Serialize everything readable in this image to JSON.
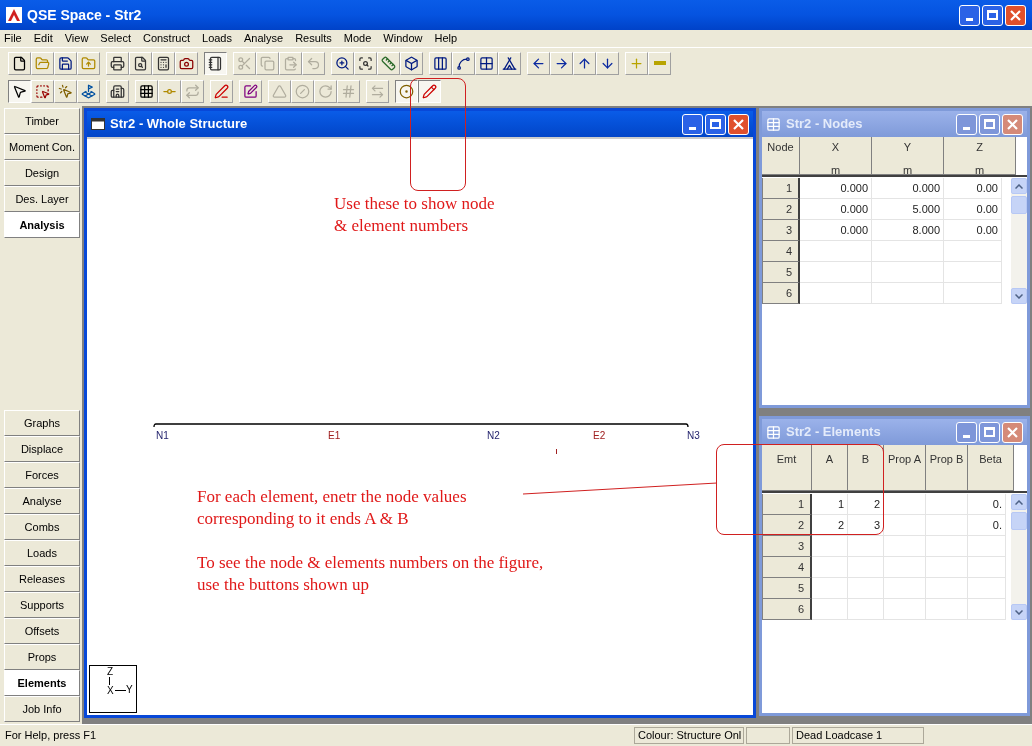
{
  "window": {
    "title": "QSE Space - Str2"
  },
  "menu": [
    "File",
    "Edit",
    "View",
    "Select",
    "Construct",
    "Loads",
    "Analyse",
    "Results",
    "Mode",
    "Window",
    "Help"
  ],
  "toolbar_1": [
    {
      "disabled": false,
      "pressed": false
    },
    {
      "disabled": false,
      "pressed": false
    },
    {
      "disabled": false,
      "pressed": false
    },
    {
      "disabled": false,
      "pressed": false
    },
    {
      "disabled": false,
      "pressed": false
    },
    {
      "disabled": false,
      "pressed": false
    },
    {
      "disabled": false,
      "pressed": false
    },
    {
      "disabled": false,
      "pressed": false
    },
    {
      "disabled": false,
      "pressed": true
    },
    {
      "disabled": true,
      "pressed": false
    },
    {
      "disabled": true,
      "pressed": false
    },
    {
      "disabled": true,
      "pressed": false
    },
    {
      "disabled": true,
      "pressed": false
    },
    {
      "disabled": false,
      "pressed": false
    },
    {
      "disabled": false,
      "pressed": false
    },
    {
      "disabled": false,
      "pressed": false
    },
    {
      "disabled": false,
      "pressed": false
    },
    {
      "disabled": false,
      "pressed": false
    },
    {
      "disabled": false,
      "pressed": false
    },
    {
      "disabled": false,
      "pressed": false
    },
    {
      "disabled": false,
      "pressed": false
    },
    {
      "disabled": false,
      "pressed": false
    },
    {
      "disabled": false,
      "pressed": false
    },
    {
      "disabled": false,
      "pressed": false
    },
    {
      "disabled": false,
      "pressed": false
    },
    {
      "disabled": false,
      "pressed": false
    },
    {
      "disabled": false,
      "pressed": false
    }
  ],
  "toolbar_2": [
    {
      "disabled": false,
      "pressed": true
    },
    {
      "disabled": false,
      "pressed": false
    },
    {
      "disabled": false,
      "pressed": false
    },
    {
      "disabled": false,
      "pressed": false
    },
    {
      "disabled": false,
      "pressed": false
    },
    {
      "disabled": false,
      "pressed": false
    },
    {
      "disabled": false,
      "pressed": false
    },
    {
      "disabled": true,
      "pressed": false
    },
    {
      "disabled": false,
      "pressed": false
    },
    {
      "disabled": false,
      "pressed": false
    },
    {
      "disabled": true,
      "pressed": false
    },
    {
      "disabled": true,
      "pressed": false
    },
    {
      "disabled": true,
      "pressed": false
    },
    {
      "disabled": true,
      "pressed": false
    },
    {
      "disabled": true,
      "pressed": false
    },
    {
      "disabled": false,
      "pressed": true
    },
    {
      "disabled": false,
      "pressed": true
    }
  ],
  "sidebar": {
    "top": [
      {
        "label": "Timber",
        "selected": false
      },
      {
        "label": "Moment Con.",
        "selected": false
      },
      {
        "label": "Design",
        "selected": false
      },
      {
        "label": "Des. Layer",
        "selected": false
      },
      {
        "label": "Analysis",
        "selected": true
      }
    ],
    "bottom": [
      {
        "label": "Graphs",
        "selected": false
      },
      {
        "label": "Displace",
        "selected": false
      },
      {
        "label": "Forces",
        "selected": false
      },
      {
        "label": "Analyse",
        "selected": false
      },
      {
        "label": "Combs",
        "selected": false
      },
      {
        "label": "Loads",
        "selected": false
      },
      {
        "label": "Releases",
        "selected": false
      },
      {
        "label": "Supports",
        "selected": false
      },
      {
        "label": "Offsets",
        "selected": false
      },
      {
        "label": "Props",
        "selected": false
      },
      {
        "label": "Elements",
        "selected": true
      },
      {
        "label": "Job Info",
        "selected": false
      }
    ]
  },
  "structure_window": {
    "title": "Str2 - Whole Structure",
    "active": true,
    "nodes": [
      {
        "label": "N1"
      },
      {
        "label": "N2"
      },
      {
        "label": "N3"
      }
    ],
    "elements": [
      {
        "label": "E1"
      },
      {
        "label": "E2"
      }
    ],
    "axes": {
      "vertical": "Z",
      "horizontal": "Y",
      "out_of_plane": "X"
    }
  },
  "nodes_window": {
    "title": "Str2 - Nodes",
    "active": false,
    "columns": [
      {
        "label": "Node"
      },
      {
        "label": "X",
        "unit": "m"
      },
      {
        "label": "Y",
        "unit": "m"
      },
      {
        "label": "Z",
        "unit": "m"
      }
    ],
    "rows": [
      {
        "id": "1",
        "cells": [
          "0.000",
          "0.000",
          "0.00"
        ]
      },
      {
        "id": "2",
        "cells": [
          "0.000",
          "5.000",
          "0.00"
        ]
      },
      {
        "id": "3",
        "cells": [
          "0.000",
          "8.000",
          "0.00"
        ]
      },
      {
        "id": "4",
        "cells": [
          "",
          "",
          ""
        ]
      },
      {
        "id": "5",
        "cells": [
          "",
          "",
          ""
        ]
      },
      {
        "id": "6",
        "cells": [
          "",
          "",
          ""
        ]
      }
    ]
  },
  "elements_window": {
    "title": "Str2 - Elements",
    "active": false,
    "columns": [
      "Emt",
      "A",
      "B",
      "Prop A",
      "Prop B",
      "Beta"
    ],
    "rows": [
      {
        "id": "1",
        "cells": [
          "1",
          "2",
          "",
          "",
          "0."
        ]
      },
      {
        "id": "2",
        "cells": [
          "2",
          "3",
          "",
          "",
          "0."
        ]
      },
      {
        "id": "3",
        "cells": [
          "",
          "",
          "",
          "",
          ""
        ]
      },
      {
        "id": "4",
        "cells": [
          "",
          "",
          "",
          "",
          ""
        ]
      },
      {
        "id": "5",
        "cells": [
          "",
          "",
          "",
          "",
          ""
        ]
      },
      {
        "id": "6",
        "cells": [
          "",
          "",
          "",
          "",
          ""
        ]
      }
    ]
  },
  "annotations": [
    "Use these to show node\n& element numbers",
    "For each element, enetr the node values\ncorresponding to it ends A & B",
    "To see the node & elements numbers on the figure,\nuse the buttons shown up"
  ],
  "status_bar": [
    "For Help, press F1",
    "Colour: Structure Onl",
    "Dead Loadcase 1"
  ]
}
